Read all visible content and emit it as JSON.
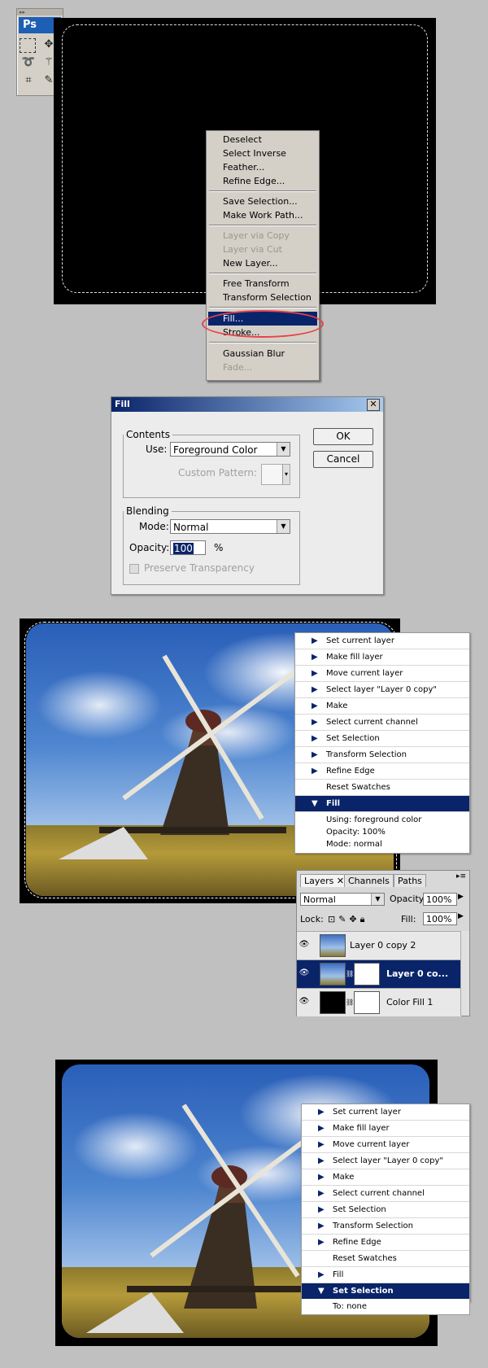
{
  "toolbox": {
    "logo": "Ps",
    "tools": [
      "marquee-icon",
      "move-icon",
      "lasso-icon",
      "magic-wand-icon",
      "crop-icon",
      "slice-icon"
    ]
  },
  "context_menu": {
    "items": [
      {
        "label": "Deselect",
        "enabled": true
      },
      {
        "label": "Select Inverse",
        "enabled": true
      },
      {
        "label": "Feather...",
        "enabled": true
      },
      {
        "label": "Refine Edge...",
        "enabled": true
      },
      {
        "label": "Save Selection...",
        "enabled": true
      },
      {
        "label": "Make Work Path...",
        "enabled": true
      },
      {
        "label": "Layer via Copy",
        "enabled": false
      },
      {
        "label": "Layer via Cut",
        "enabled": false
      },
      {
        "label": "New Layer...",
        "enabled": true
      },
      {
        "label": "Free Transform",
        "enabled": true
      },
      {
        "label": "Transform Selection",
        "enabled": true
      },
      {
        "label": "Fill...",
        "enabled": true,
        "selected": true
      },
      {
        "label": "Stroke...",
        "enabled": true
      },
      {
        "label": "Gaussian Blur",
        "enabled": true
      },
      {
        "label": "Fade...",
        "enabled": false
      }
    ],
    "highlight_color": "#e8434b"
  },
  "fill_dialog": {
    "title": "Fill",
    "close": "✕",
    "contents_legend": "Contents",
    "use_label": "Use:",
    "use_value": "Foreground Color",
    "custom_pattern_label": "Custom Pattern:",
    "blending_legend": "Blending",
    "mode_label": "Mode:",
    "mode_value": "Normal",
    "opacity_label": "Opacity:",
    "opacity_value": "100",
    "opacity_unit": "%",
    "preserve_label": "Preserve Transparency",
    "ok": "OK",
    "cancel": "Cancel"
  },
  "actions1": {
    "rows": [
      {
        "label": "Set current layer"
      },
      {
        "label": "Make fill layer"
      },
      {
        "label": "Move current layer"
      },
      {
        "label": "Select layer \"Layer 0 copy\""
      },
      {
        "label": "Make"
      },
      {
        "label": "Select current channel"
      },
      {
        "label": "Set Selection"
      },
      {
        "label": "Transform Selection"
      },
      {
        "label": "Refine Edge"
      },
      {
        "label": "Reset Swatches"
      }
    ],
    "selected": "Fill",
    "details": [
      "Using: foreground color",
      "Opacity: 100%",
      "Mode: normal"
    ]
  },
  "layers_panel": {
    "tabs": [
      "Layers",
      "Channels",
      "Paths"
    ],
    "blend_mode": "Normal",
    "opacity_label": "Opacity:",
    "opacity_value": "100%",
    "lock_label": "Lock:",
    "fill_label": "Fill:",
    "fill_value": "100%",
    "layers": [
      {
        "name": "Layer 0 copy 2",
        "selected": false
      },
      {
        "name": "Layer 0 co...",
        "selected": true
      },
      {
        "name": "Color Fill 1",
        "selected": false
      }
    ]
  },
  "actions2": {
    "rows": [
      {
        "label": "Set current layer"
      },
      {
        "label": "Make fill layer"
      },
      {
        "label": "Move current layer"
      },
      {
        "label": "Select layer \"Layer 0 copy\""
      },
      {
        "label": "Make"
      },
      {
        "label": "Select current channel"
      },
      {
        "label": "Set Selection"
      },
      {
        "label": "Transform Selection"
      },
      {
        "label": "Refine Edge"
      },
      {
        "label": "Reset Swatches"
      },
      {
        "label": "Fill"
      }
    ],
    "selected": "Set Selection",
    "details": [
      "To: none"
    ]
  }
}
